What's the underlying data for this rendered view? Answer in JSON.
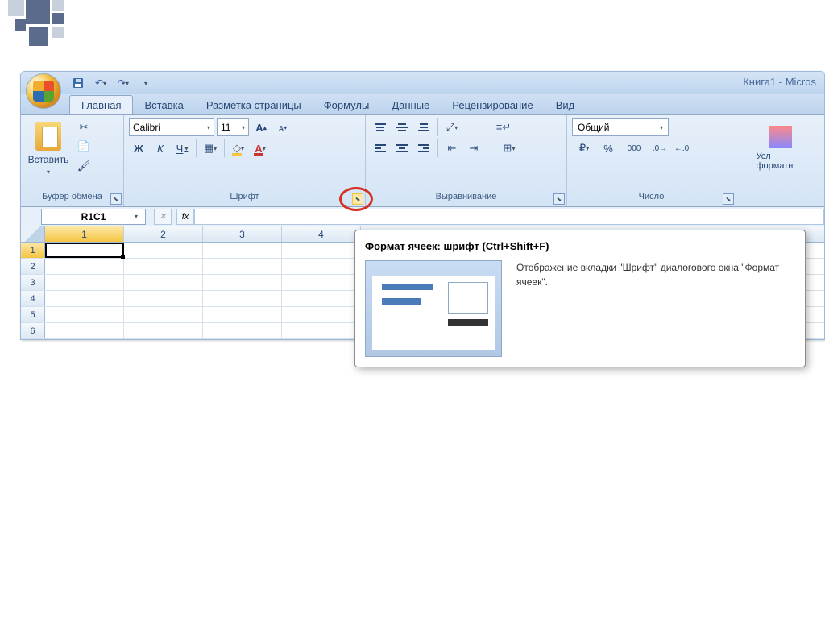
{
  "title": "Книга1 - Micros",
  "tabs": {
    "home": "Главная",
    "insert": "Вставка",
    "layout": "Разметка страницы",
    "formulas": "Формулы",
    "data": "Данные",
    "review": "Рецензирование",
    "view": "Вид"
  },
  "groups": {
    "clipboard": {
      "label": "Буфер обмена",
      "paste": "Вставить"
    },
    "font": {
      "label": "Шрифт",
      "name": "Calibri",
      "size": "11",
      "bold": "Ж",
      "italic": "К",
      "underline": "Ч"
    },
    "alignment": {
      "label": "Выравнивание"
    },
    "number": {
      "label": "Число",
      "format": "Общий",
      "pct": "%",
      "thou": "000"
    },
    "cond": {
      "label": "Усл форматн"
    }
  },
  "namebox": "R1C1",
  "fx": "fx",
  "columns": [
    "1",
    "2",
    "3",
    "4"
  ],
  "rows": [
    "1",
    "2",
    "3",
    "4",
    "5",
    "6"
  ],
  "tooltip": {
    "title": "Формат ячеек: шрифт (Ctrl+Shift+F)",
    "desc": "Отображение вкладки \"Шрифт\" диалогового окна \"Формат ячеек\"."
  }
}
